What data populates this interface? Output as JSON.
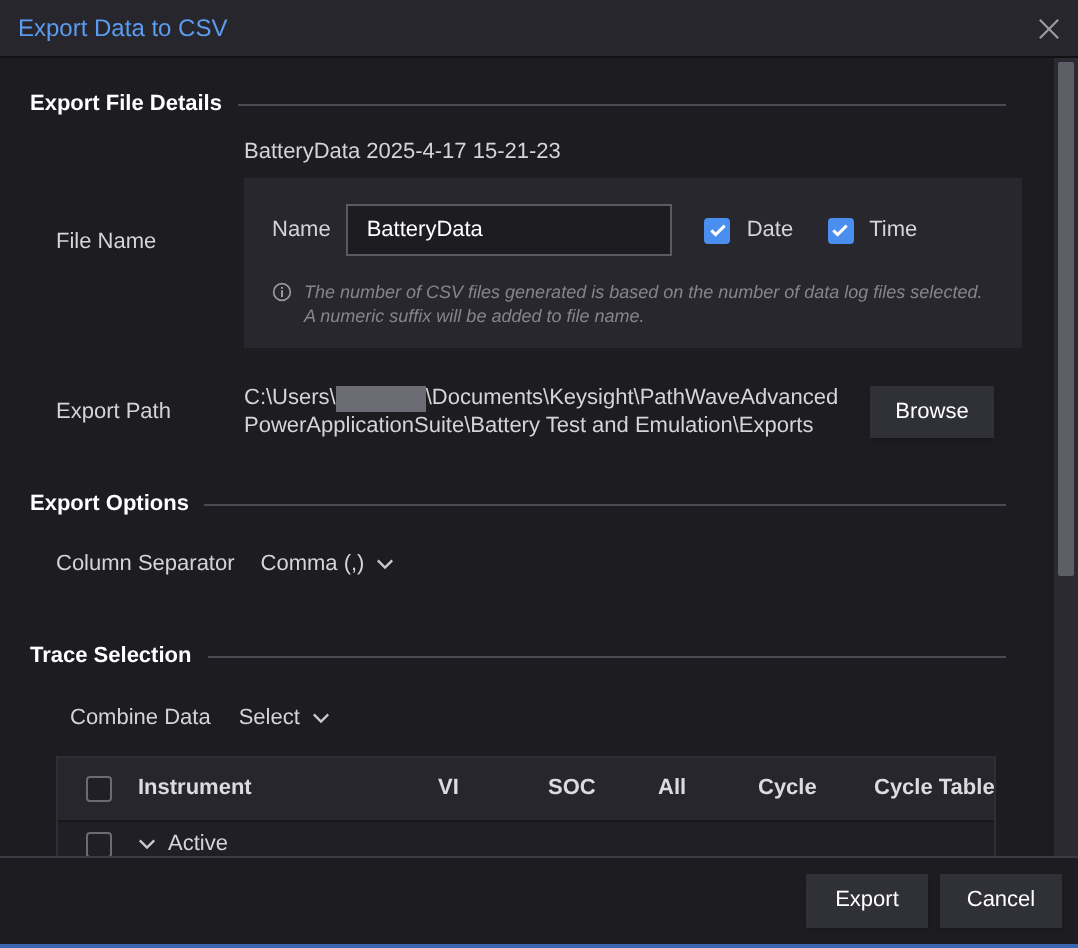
{
  "window": {
    "title": "Export Data to CSV"
  },
  "file_details": {
    "heading": "Export File Details",
    "preview": "BatteryData 2025-4-17 15-21-23",
    "label": "File Name",
    "name_label": "Name",
    "name_value": "BatteryData",
    "options": [
      {
        "label": "Date",
        "checked": true
      },
      {
        "label": "Time",
        "checked": true
      }
    ],
    "note": "The number of CSV files generated is based on the number of data log files selected. A numeric suffix will be added to file name."
  },
  "export_path": {
    "label": "Export Path",
    "prefix": "C:\\Users\\",
    "rest_line_1": "\\Documents\\Keysight\\PathWaveAdvanced",
    "rest_line_2": "PowerApplicationSuite\\Battery Test and Emulation\\Exports",
    "button": "Browse"
  },
  "export_options": {
    "heading": "Export Options",
    "separator_label": "Column Separator",
    "separator_value": "Comma (,)"
  },
  "trace_selection": {
    "heading": "Trace Selection",
    "combine_label": "Combine Data",
    "combine_value": "Select",
    "table": {
      "select_all_checked": false,
      "columns": [
        "Instrument",
        "VI",
        "SOC",
        "All",
        "Cycle",
        "Cycle Table"
      ],
      "rows": [
        {
          "label": "Active",
          "checked": false,
          "expanded": true
        }
      ]
    }
  },
  "buttons": [
    "Export",
    "Cancel"
  ]
}
